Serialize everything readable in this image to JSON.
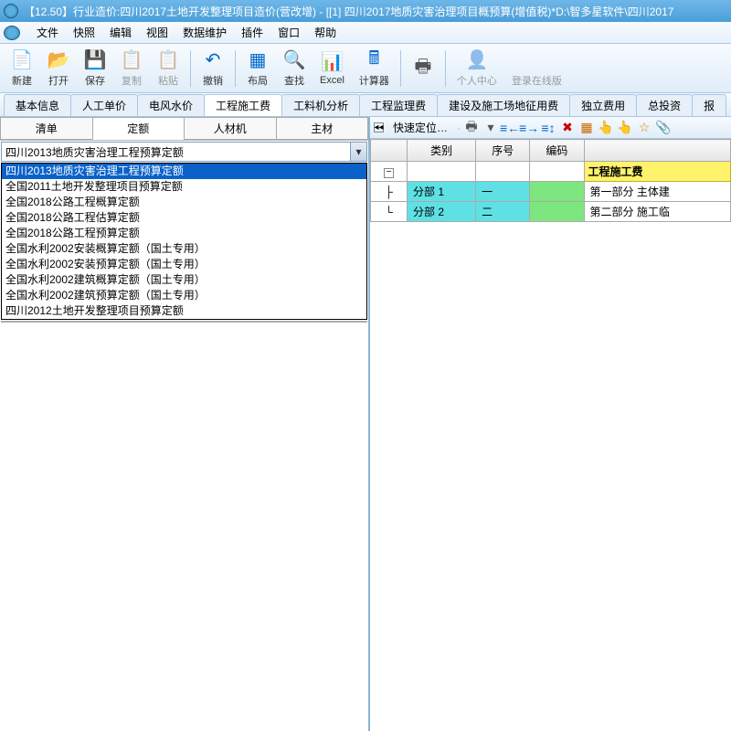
{
  "titlebar": "【12.50】行业造价:四川2017土地开发整理项目造价(营改增) - [[1] 四川2017地质灾害治理项目概预算(增值税)*D:\\智多星软件\\四川2017",
  "menus": [
    "文件",
    "快照",
    "编辑",
    "视图",
    "数据维护",
    "插件",
    "窗口",
    "帮助"
  ],
  "toolbar": [
    {
      "icon": "📄",
      "label": "新建",
      "c": "#3a7"
    },
    {
      "icon": "📂",
      "label": "打开",
      "c": "#d90"
    },
    {
      "icon": "💾",
      "label": "保存",
      "c": "#090"
    },
    {
      "icon": "📋",
      "label": "复制",
      "c": "#aaa",
      "dis": true
    },
    {
      "icon": "📋",
      "label": "粘贴",
      "c": "#aaa",
      "dis": true
    },
    {
      "sep": true
    },
    {
      "icon": "↶",
      "label": "撤销",
      "c": "#06c"
    },
    {
      "sep": true
    },
    {
      "icon": "▦",
      "label": "布局",
      "c": "#06c"
    },
    {
      "icon": "🔍",
      "label": "查找",
      "c": "#06c"
    },
    {
      "icon": "📊",
      "label": "Excel",
      "c": "#090"
    },
    {
      "icon": "🖩",
      "label": "计算器",
      "c": "#06c"
    },
    {
      "sep": true
    },
    {
      "icon": "🖶",
      "label": "",
      "c": "#555"
    },
    {
      "sep": true
    },
    {
      "icon": "👤",
      "label": "个人中心",
      "c": "#888",
      "dis": true
    },
    {
      "icon": "",
      "label": "登录在线版",
      "c": "#888",
      "dis": true
    }
  ],
  "maintabs": [
    "基本信息",
    "人工单价",
    "电风水价",
    "工程施工费",
    "工料机分析",
    "工程监理费",
    "建设及施工场地征用费",
    "独立费用",
    "总投资",
    "报"
  ],
  "active_maintab": 3,
  "lefttabs": [
    "清单",
    "定额",
    "人材机",
    "主材"
  ],
  "active_lefttab": 1,
  "combo_value": "四川2013地质灾害治理工程预算定额",
  "dropdown_items": [
    "四川2013地质灾害治理工程预算定额",
    "全国2011土地开发整理项目预算定额",
    "全国2018公路工程概算定额",
    "全国2018公路工程估算定额",
    "全国2018公路工程预算定额",
    "全国水利2002安装概算定额（国土专用）",
    "全国水利2002安装预算定额（国土专用）",
    "全国水利2002建筑概算定额（国土专用）",
    "全国水利2002建筑预算定额（国土专用）",
    "四川2012土地开发整理项目预算定额"
  ],
  "quickbar_label": "快速定位…",
  "quickbar_icons": [
    {
      "t": "🖶",
      "c": "#555"
    },
    {
      "t": "▾",
      "c": "#555"
    },
    {
      "t": "≡←",
      "c": "#06c"
    },
    {
      "t": "≡→",
      "c": "#06c"
    },
    {
      "t": "≡↕",
      "c": "#06c"
    },
    {
      "t": "✖",
      "c": "#c00"
    },
    {
      "t": "▦",
      "c": "#c60"
    },
    {
      "t": "👆",
      "c": "#ea0"
    },
    {
      "t": "👆",
      "c": "#ea0"
    },
    {
      "t": "☆",
      "c": "#c80"
    },
    {
      "t": "📎",
      "c": "#c00"
    }
  ],
  "grid": {
    "headers": [
      "",
      "类别",
      "序号",
      "编码",
      ""
    ],
    "summary_row": "工程施工费",
    "rows": [
      {
        "cat": "分部 1",
        "num": "一",
        "code": "",
        "desc": "第一部分 主体建"
      },
      {
        "cat": "分部 2",
        "num": "二",
        "code": "",
        "desc": "第二部分 施工临"
      }
    ]
  }
}
